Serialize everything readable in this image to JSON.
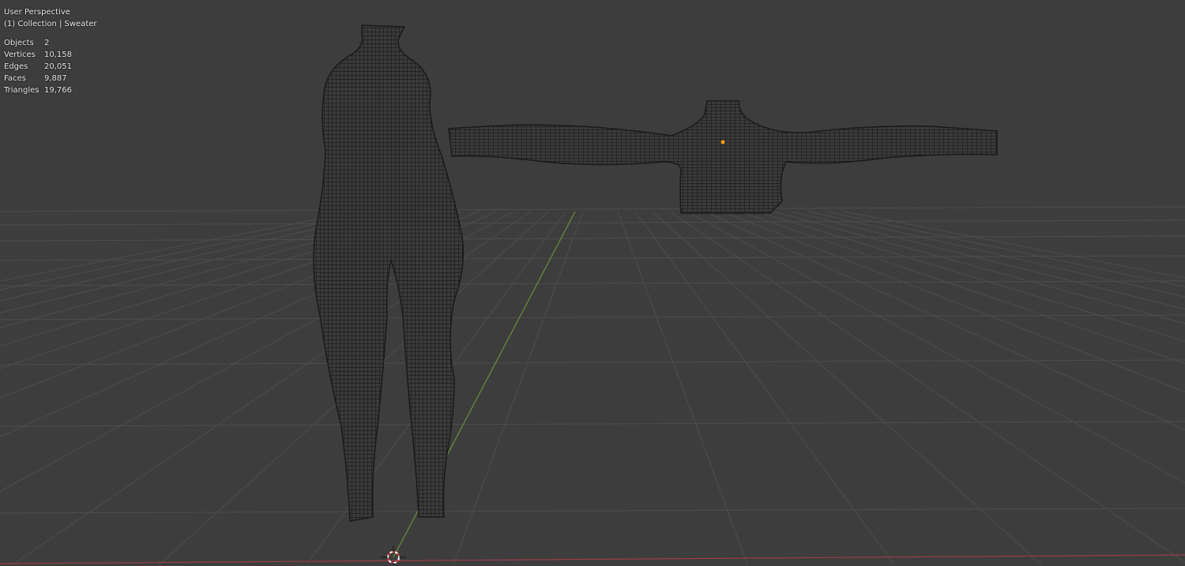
{
  "viewport": {
    "view_name": "User Perspective",
    "collection_info": "(1) Collection | Sweater",
    "stats": [
      {
        "label": "Objects",
        "value": "2"
      },
      {
        "label": "Vertices",
        "value": "10,158"
      },
      {
        "label": "Edges",
        "value": "20,051"
      },
      {
        "label": "Faces",
        "value": "9,887"
      },
      {
        "label": "Triangles",
        "value": "19,766"
      }
    ]
  },
  "colors": {
    "background": "#3d3d3d",
    "grid": "#4a4a4a",
    "x_axis": "#9a3d47",
    "y_axis": "#6b8f3a",
    "origin": "#ff9a1a"
  }
}
